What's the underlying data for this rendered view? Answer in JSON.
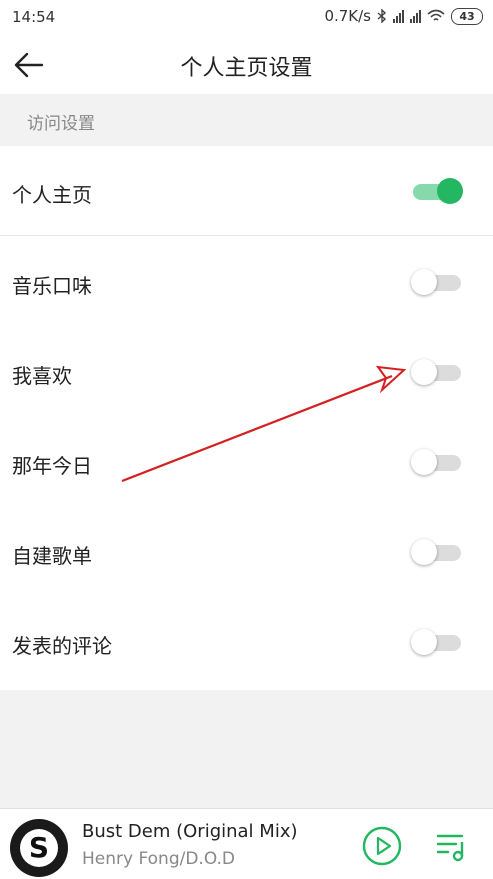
{
  "status_bar": {
    "time": "14:54",
    "network_speed": "0.7K/s",
    "battery": "43"
  },
  "app_bar": {
    "title": "个人主页设置",
    "back_icon": "arrow-left-icon"
  },
  "section": {
    "title": "访问设置"
  },
  "settings": [
    {
      "label": "个人主页",
      "enabled": true
    },
    {
      "label": "音乐口味",
      "enabled": false
    },
    {
      "label": "我喜欢",
      "enabled": false
    },
    {
      "label": "那年今日",
      "enabled": false
    },
    {
      "label": "自建歌单",
      "enabled": false
    },
    {
      "label": "发表的评论",
      "enabled": false
    }
  ],
  "colors": {
    "accent": "#22b760",
    "toggle_on_track": "#86d9aa",
    "toggle_off_track": "#dcdcdc",
    "annotation_arrow": "#d42020"
  },
  "player": {
    "song_title": "Bust Dem (Original Mix)",
    "artist": "Henry Fong/D.O.D",
    "album_logo": "S"
  }
}
